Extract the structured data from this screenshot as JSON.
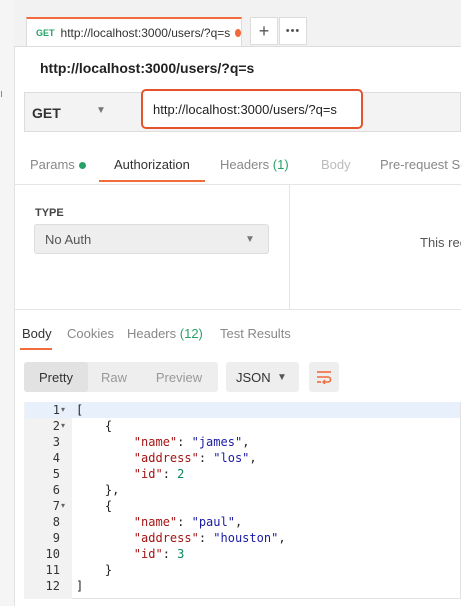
{
  "tab": {
    "method": "GET",
    "url": "http://localhost:3000/users/?q=s"
  },
  "toolbar": {
    "new_tab": "+",
    "more": "•••"
  },
  "request": {
    "title": "http://localhost:3000/users/?q=s",
    "method": "GET",
    "url": "http://localhost:3000/users/?q=s"
  },
  "request_tabs": {
    "params": "Params",
    "authorization": "Authorization",
    "headers": "Headers",
    "headers_count": "(1)",
    "body": "Body",
    "prerequest": "Pre-request Sc"
  },
  "auth": {
    "type_label": "TYPE",
    "type_value": "No Auth",
    "hint": "This rec"
  },
  "response_tabs": {
    "body": "Body",
    "cookies": "Cookies",
    "headers": "Headers",
    "headers_count": "(12)",
    "test_results": "Test Results"
  },
  "view": {
    "pretty": "Pretty",
    "raw": "Raw",
    "preview": "Preview",
    "format": "JSON"
  },
  "code_lines": [
    "[",
    "    {",
    "        \"name\": \"james\",",
    "        \"address\": \"los\",",
    "        \"id\": 2",
    "    },",
    "    {",
    "        \"name\": \"paul\",",
    "        \"address\": \"houston\",",
    "        \"id\": 3",
    "    }",
    "]"
  ],
  "line_numbers": [
    "1",
    "2",
    "3",
    "4",
    "5",
    "6",
    "7",
    "8",
    "9",
    "10",
    "11",
    "12"
  ],
  "colors": {
    "accent": "#f26b3a",
    "green": "#26a269",
    "highlight_border": "#e4532c"
  }
}
